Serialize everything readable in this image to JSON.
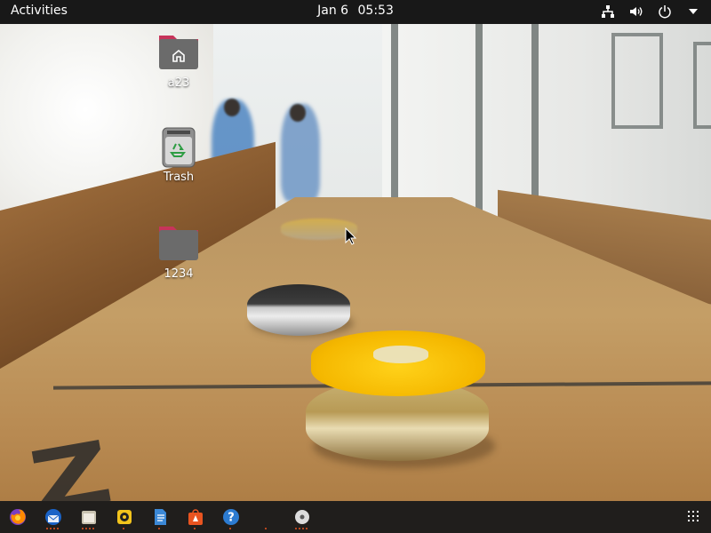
{
  "top_bar": {
    "activities_label": "Activities",
    "date": "Jan 6",
    "time": "05:53",
    "tray_icons": [
      "network-icon",
      "volume-icon",
      "power-icon",
      "system-menu-arrow-icon"
    ]
  },
  "desktop": {
    "icons": [
      {
        "label": "a23",
        "icon": "home-folder-icon"
      },
      {
        "label": "Trash",
        "icon": "trash-icon"
      },
      {
        "label": "1234",
        "icon": "folder-icon"
      }
    ]
  },
  "dock": {
    "items": [
      {
        "icon": "firefox-icon",
        "running_dots": 0
      },
      {
        "icon": "thunderbird-icon",
        "running_dots": 4
      },
      {
        "icon": "files-icon",
        "running_dots": 4
      },
      {
        "icon": "rhythmbox-icon",
        "running_dots": 1
      },
      {
        "icon": "libreoffice-writer-icon",
        "running_dots": 1
      },
      {
        "icon": "software-center-icon",
        "running_dots": 1
      },
      {
        "icon": "help-icon",
        "running_dots": 1
      },
      {
        "icon": "empty-slot",
        "running_dots": 1
      },
      {
        "icon": "disc-icon",
        "running_dots": 4
      }
    ],
    "show_apps_icon": "show-applications-icon"
  },
  "colors": {
    "top_bar_bg": "#181818",
    "dock_bg": "#181818",
    "running_indicator": "#e95420",
    "folder_tab": "#c7345a",
    "folder_body": "#6b6b6b"
  }
}
